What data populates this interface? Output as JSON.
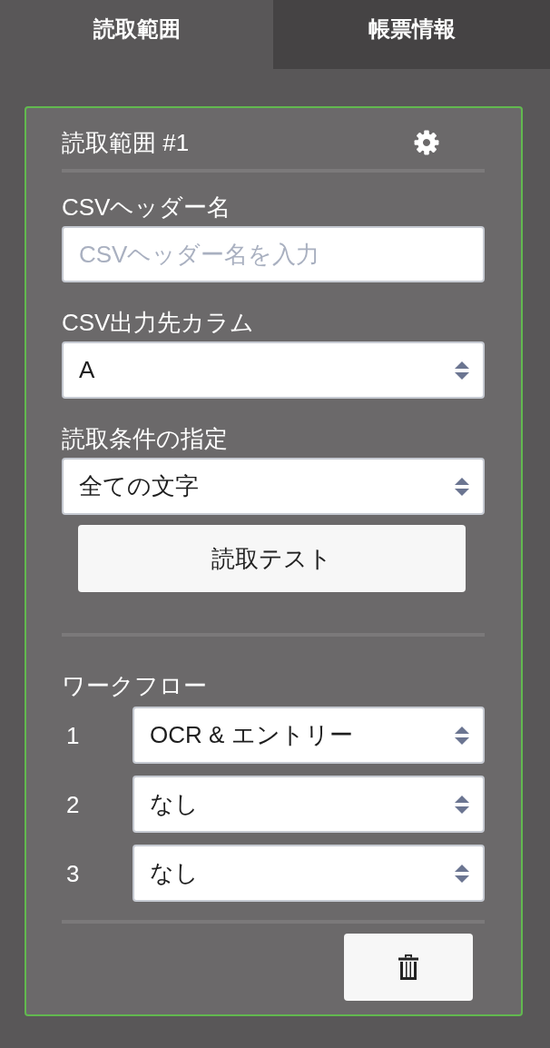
{
  "tabs": [
    {
      "label": "読取範囲",
      "selected": true
    },
    {
      "label": "帳票情報",
      "selected": false
    }
  ],
  "range_card": {
    "title": "読取範囲 #1",
    "fields": [
      {
        "kind": "input",
        "label": "CSVヘッダー名",
        "placeholder": "CSVヘッダー名を入力"
      },
      {
        "kind": "select",
        "label": "CSV出力先カラム",
        "value": "A"
      },
      {
        "kind": "select",
        "label": "読取条件の指定",
        "value": "全ての文字"
      }
    ],
    "test_button": "読取テスト",
    "workflow": {
      "label": "ワークフロー",
      "steps": [
        {
          "number": "1",
          "value": "OCR & エントリー"
        },
        {
          "number": "2",
          "value": "なし"
        },
        {
          "number": "3",
          "value": "なし"
        }
      ]
    }
  }
}
